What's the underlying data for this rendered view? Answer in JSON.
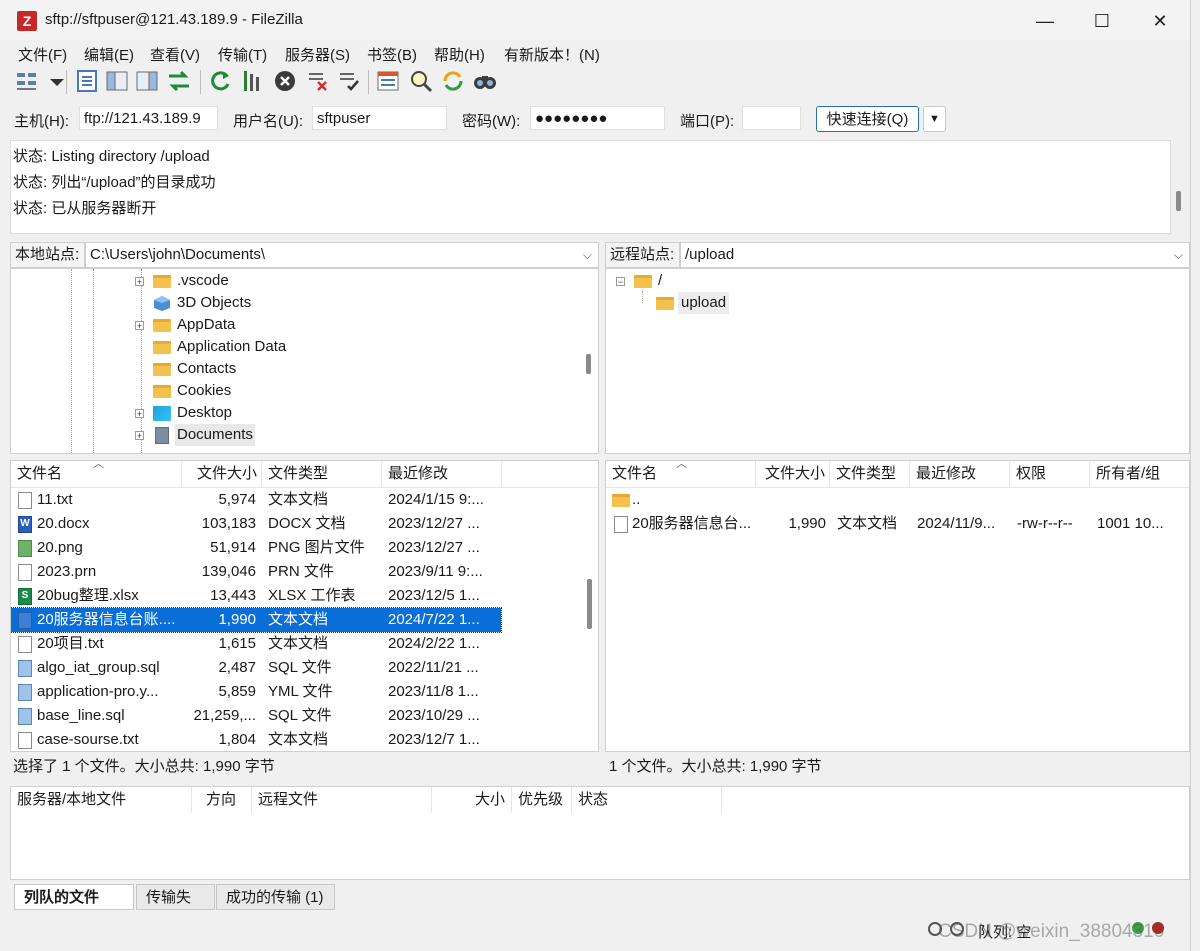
{
  "window": {
    "title": "sftp://sftpuser@121.43.189.9 - FileZilla",
    "app_icon": "Z"
  },
  "menu": [
    "文件(F)",
    "编辑(E)",
    "查看(V)",
    "传输(T)",
    "服务器(S)",
    "书签(B)",
    "帮助(H)",
    "有新版本！(N)"
  ],
  "quickconnect": {
    "host_label": "主机(H):",
    "host_value": "ftp://121.43.189.9",
    "user_label": "用户名(U):",
    "user_value": "sftpuser",
    "pass_label": "密码(W):",
    "pass_value": "●●●●●●●●",
    "port_label": "端口(P):",
    "port_value": "",
    "button": "快速连接(Q)",
    "dropdown": "▼"
  },
  "log": [
    "状态:  Listing directory /upload",
    "状态:  列出“/upload”的目录成功",
    "状态:  已从服务器断开"
  ],
  "local": {
    "site_label": "本地站点:",
    "path": "C:\\Users\\john\\Documents\\",
    "tree": [
      {
        "name": ".vscode",
        "icon": "folder",
        "expandable": true
      },
      {
        "name": "3D Objects",
        "icon": "cube",
        "expandable": false
      },
      {
        "name": "AppData",
        "icon": "folder",
        "expandable": true
      },
      {
        "name": "Application Data",
        "icon": "folder",
        "expandable": false
      },
      {
        "name": "Contacts",
        "icon": "folder",
        "expandable": false
      },
      {
        "name": "Cookies",
        "icon": "folder",
        "expandable": false
      },
      {
        "name": "Desktop",
        "icon": "desktop",
        "expandable": true
      },
      {
        "name": "Documents",
        "icon": "document-folder",
        "expandable": true
      }
    ],
    "columns": [
      "文件名",
      "文件大小",
      "文件类型",
      "最近修改"
    ],
    "files": [
      {
        "name": "11.txt",
        "size": "5,974",
        "type": "文本文档",
        "modified": "2024/1/15 9:...",
        "icon": "txt"
      },
      {
        "name": "20.docx",
        "size": "103,183",
        "type": "DOCX 文档",
        "modified": "2023/12/27 ...",
        "icon": "docx"
      },
      {
        "name": "20.png",
        "size": "51,914",
        "type": "PNG 图片文件",
        "modified": "2023/12/27 ...",
        "icon": "png"
      },
      {
        "name": "2023.prn",
        "size": "139,046",
        "type": "PRN 文件",
        "modified": "2023/9/11 9:...",
        "icon": "blank"
      },
      {
        "name": "20bug整理.xlsx",
        "size": "13,443",
        "type": "XLSX 工作表",
        "modified": "2023/12/5 1...",
        "icon": "xlsx"
      },
      {
        "name": "20服务器信息台账....",
        "size": "1,990",
        "type": "文本文档",
        "modified": "2024/7/22 1...",
        "icon": "txt-blue",
        "selected": true
      },
      {
        "name": "20项目.txt",
        "size": "1,615",
        "type": "文本文档",
        "modified": "2024/2/22 1...",
        "icon": "txt"
      },
      {
        "name": "algo_iat_group.sql",
        "size": "2,487",
        "type": "SQL 文件",
        "modified": "2022/11/21 ...",
        "icon": "sql"
      },
      {
        "name": "application-pro.y...",
        "size": "5,859",
        "type": "YML 文件",
        "modified": "2023/11/8 1...",
        "icon": "sql"
      },
      {
        "name": "base_line.sql",
        "size": "21,259,...",
        "type": "SQL 文件",
        "modified": "2023/10/29 ...",
        "icon": "sql"
      },
      {
        "name": "case-sourse.txt",
        "size": "1,804",
        "type": "文本文档",
        "modified": "2023/12/7 1...",
        "icon": "txt"
      }
    ],
    "status": "选择了 1 个文件。大小总共: 1,990 字节"
  },
  "remote": {
    "site_label": "远程站点:",
    "path": "/upload",
    "tree": [
      {
        "name": "/",
        "icon": "folder"
      },
      {
        "name": "upload",
        "icon": "folder"
      }
    ],
    "columns": [
      "文件名",
      "文件大小",
      "文件类型",
      "最近修改",
      "权限",
      "所有者/组"
    ],
    "files": [
      {
        "name": "..",
        "size": "",
        "type": "",
        "modified": "",
        "perm": "",
        "owner": "",
        "icon": "folder"
      },
      {
        "name": "20服务器信息台...",
        "size": "1,990",
        "type": "文本文档",
        "modified": "2024/11/9...",
        "perm": "-rw-r--r--",
        "owner": "1001 10...",
        "icon": "txt"
      }
    ],
    "status": "1 个文件。大小总共: 1,990 字节"
  },
  "queue": {
    "columns": [
      "服务器/本地文件",
      "方向",
      "远程文件",
      "大小",
      "优先级",
      "状态"
    ],
    "tabs": [
      "列队的文件",
      "传输失败",
      "成功的传输 (1)"
    ]
  },
  "statusbar": {
    "queue_text": "队列: 空",
    "watermark": "CSDN @weixin_38804310"
  }
}
